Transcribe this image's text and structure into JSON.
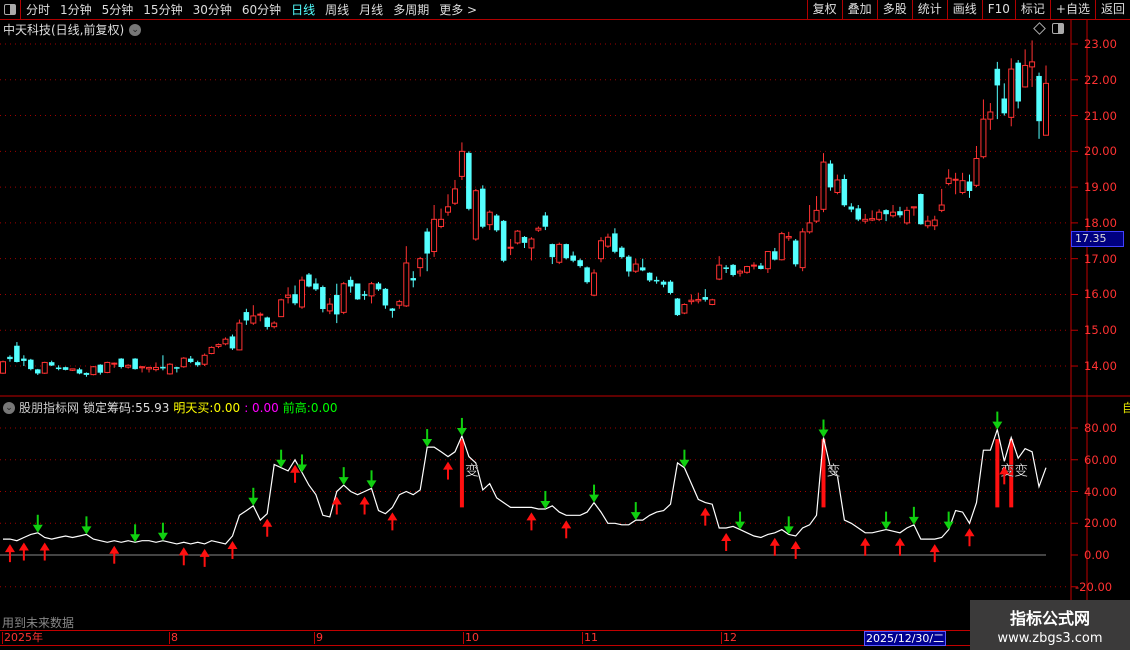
{
  "toolbar": {
    "periods": [
      "分时",
      "1分钟",
      "5分钟",
      "15分钟",
      "30分钟",
      "60分钟",
      "日线",
      "周线",
      "月线",
      "多周期",
      "更多 >"
    ],
    "active_period": "日线",
    "buttons": [
      "复权",
      "叠加",
      "多股",
      "统计",
      "画线",
      "F10",
      "标记",
      "+自选",
      "返回"
    ]
  },
  "stock": {
    "title": "中天科技(日线,前复权)"
  },
  "price_axis": {
    "labels": [
      "23.00",
      "22.00",
      "21.00",
      "20.00",
      "19.00",
      "18.00",
      "17.00",
      "16.00",
      "15.00",
      "14.00"
    ],
    "current_price": "17.35"
  },
  "indicator": {
    "name": "股朋指标网",
    "lock_label": "锁定筹码:",
    "lock_value": "55.93",
    "buy_label": "明天买:",
    "buy_value": "0.00",
    "magenta_value": ": 0.00",
    "high_label": "前高:",
    "high_value": "0.00",
    "axis_labels": [
      "80.00",
      "60.00",
      "40.00",
      "20.00",
      "0.00",
      "-20.00"
    ],
    "change_text": "变",
    "future_note": "用到未来数据"
  },
  "date_axis": {
    "labels": [
      "2025年",
      "8",
      "9",
      "10",
      "11",
      "12"
    ],
    "selected_date": "2025/12/30/二"
  },
  "sidebar": {
    "auto_label": "自"
  },
  "watermark": {
    "line1": "指标公式网",
    "line2": "www.zbgs3.com"
  },
  "colors": {
    "up": "#ff3232",
    "down": "#54ffff",
    "buy_arrow": "#ff1010",
    "sell_arrow": "#10d010",
    "line": "#ffffff",
    "grid": "#a00000",
    "active": "#54ffff"
  },
  "chart_data": [
    {
      "type": "candlestick",
      "ylim": [
        13.6,
        23.25
      ],
      "ohlc": [
        [
          13.8,
          14.15,
          13.78,
          14.12
        ],
        [
          14.25,
          14.3,
          14.12,
          14.2
        ],
        [
          14.56,
          14.67,
          14.1,
          14.12
        ],
        [
          14.2,
          14.3,
          14.0,
          14.15
        ],
        [
          14.17,
          14.2,
          13.88,
          13.92
        ],
        [
          13.9,
          13.92,
          13.75,
          13.8
        ],
        [
          13.8,
          14.12,
          13.78,
          14.1
        ],
        [
          14.1,
          14.15,
          14.0,
          14.02
        ],
        [
          13.95,
          14.02,
          13.88,
          13.94
        ],
        [
          13.96,
          13.98,
          13.88,
          13.9
        ],
        [
          13.88,
          13.93,
          13.86,
          13.92
        ],
        [
          13.9,
          13.95,
          13.77,
          13.8
        ],
        [
          13.8,
          13.82,
          13.7,
          13.76
        ],
        [
          13.76,
          14.0,
          13.74,
          13.98
        ],
        [
          14.03,
          14.05,
          13.76,
          13.82
        ],
        [
          13.82,
          14.12,
          13.8,
          14.1
        ],
        [
          14.08,
          14.1,
          13.95,
          14.08
        ],
        [
          14.2,
          14.22,
          13.93,
          13.98
        ],
        [
          13.97,
          14.05,
          13.93,
          14.02
        ],
        [
          14.2,
          14.22,
          13.9,
          13.92
        ],
        [
          13.95,
          14.0,
          13.82,
          13.98
        ],
        [
          13.92,
          13.98,
          13.82,
          13.96
        ],
        [
          13.9,
          14.1,
          13.85,
          13.96
        ],
        [
          13.97,
          14.3,
          13.88,
          13.94
        ],
        [
          13.78,
          14.08,
          13.76,
          14.05
        ],
        [
          13.96,
          13.98,
          13.82,
          13.94
        ],
        [
          13.98,
          14.25,
          13.95,
          14.22
        ],
        [
          14.2,
          14.28,
          14.08,
          14.12
        ],
        [
          14.1,
          14.15,
          13.98,
          14.03
        ],
        [
          14.05,
          14.35,
          14.0,
          14.3
        ],
        [
          14.35,
          14.55,
          14.33,
          14.52
        ],
        [
          14.55,
          14.63,
          14.5,
          14.6
        ],
        [
          14.62,
          14.8,
          14.58,
          14.75
        ],
        [
          14.82,
          14.88,
          14.45,
          14.5
        ],
        [
          14.45,
          15.3,
          14.44,
          15.2
        ],
        [
          15.5,
          15.6,
          15.15,
          15.28
        ],
        [
          15.2,
          15.7,
          15.15,
          15.4
        ],
        [
          15.45,
          15.5,
          15.25,
          15.45
        ],
        [
          15.35,
          15.38,
          15.02,
          15.1
        ],
        [
          15.1,
          15.25,
          15.05,
          15.2
        ],
        [
          15.38,
          15.88,
          15.37,
          15.85
        ],
        [
          15.92,
          16.2,
          15.75,
          15.98
        ],
        [
          16.0,
          16.25,
          15.7,
          15.76
        ],
        [
          15.65,
          16.5,
          15.6,
          16.4
        ],
        [
          16.55,
          16.6,
          16.2,
          16.23
        ],
        [
          16.3,
          16.45,
          16.1,
          16.15
        ],
        [
          16.2,
          16.25,
          15.5,
          15.6
        ],
        [
          15.54,
          15.9,
          15.45,
          15.73
        ],
        [
          15.98,
          16.3,
          15.2,
          15.45
        ],
        [
          15.5,
          16.35,
          15.45,
          16.3
        ],
        [
          16.4,
          16.5,
          16.05,
          16.23
        ],
        [
          16.3,
          16.3,
          15.85,
          15.87
        ],
        [
          16.0,
          16.1,
          15.85,
          15.97
        ],
        [
          15.96,
          16.35,
          15.75,
          16.3
        ],
        [
          16.3,
          16.35,
          16.1,
          16.15
        ],
        [
          16.15,
          16.18,
          15.6,
          15.7
        ],
        [
          15.6,
          15.62,
          15.35,
          15.55
        ],
        [
          15.7,
          15.85,
          15.6,
          15.8
        ],
        [
          15.68,
          17.35,
          15.65,
          16.88
        ],
        [
          16.45,
          16.65,
          16.2,
          16.4
        ],
        [
          16.75,
          17.05,
          16.5,
          17.0
        ],
        [
          17.75,
          17.85,
          16.65,
          17.15
        ],
        [
          17.2,
          18.5,
          17.05,
          18.1
        ],
        [
          17.9,
          18.4,
          17.85,
          18.1
        ],
        [
          18.3,
          18.8,
          18.2,
          18.45
        ],
        [
          18.55,
          19.2,
          18.5,
          18.95
        ],
        [
          19.3,
          20.25,
          19.2,
          20.0
        ],
        [
          19.95,
          20.0,
          18.35,
          18.4
        ],
        [
          17.55,
          18.95,
          17.5,
          18.9
        ],
        [
          18.95,
          19.05,
          17.85,
          17.9
        ],
        [
          17.95,
          18.35,
          17.8,
          18.3
        ],
        [
          18.2,
          18.25,
          17.75,
          17.8
        ],
        [
          18.05,
          18.08,
          16.9,
          16.95
        ],
        [
          17.3,
          17.55,
          17.1,
          17.32
        ],
        [
          17.44,
          17.8,
          17.4,
          17.77
        ],
        [
          17.6,
          17.63,
          17.3,
          17.45
        ],
        [
          17.3,
          17.6,
          16.95,
          17.55
        ],
        [
          17.8,
          17.9,
          17.75,
          17.85
        ],
        [
          18.2,
          18.3,
          17.8,
          17.9
        ],
        [
          17.4,
          17.42,
          16.85,
          17.05
        ],
        [
          16.9,
          17.45,
          16.85,
          17.4
        ],
        [
          17.4,
          17.42,
          16.98,
          17.02
        ],
        [
          17.08,
          17.2,
          16.9,
          16.95
        ],
        [
          16.95,
          17.0,
          16.75,
          16.8
        ],
        [
          16.75,
          16.78,
          16.3,
          16.35
        ],
        [
          15.98,
          16.7,
          15.95,
          16.6
        ],
        [
          17.0,
          17.6,
          16.9,
          17.5
        ],
        [
          17.35,
          17.7,
          17.3,
          17.6
        ],
        [
          17.7,
          17.85,
          17.15,
          17.2
        ],
        [
          17.3,
          17.35,
          17.0,
          17.05
        ],
        [
          17.05,
          17.1,
          16.5,
          16.65
        ],
        [
          16.65,
          17.0,
          16.6,
          16.85
        ],
        [
          16.75,
          17.0,
          16.65,
          16.68
        ],
        [
          16.6,
          16.62,
          16.35,
          16.4
        ],
        [
          16.4,
          16.5,
          16.3,
          16.38
        ],
        [
          16.35,
          16.4,
          16.2,
          16.28
        ],
        [
          16.35,
          16.4,
          16.0,
          16.05
        ],
        [
          15.88,
          15.9,
          15.4,
          15.43
        ],
        [
          15.48,
          15.75,
          15.45,
          15.72
        ],
        [
          15.8,
          16.0,
          15.72,
          15.84
        ],
        [
          15.82,
          16.05,
          15.75,
          15.86
        ],
        [
          15.92,
          16.15,
          15.8,
          15.86
        ],
        [
          15.72,
          15.88,
          15.7,
          15.85
        ],
        [
          16.43,
          17.07,
          16.4,
          16.82
        ],
        [
          16.75,
          16.82,
          16.6,
          16.72
        ],
        [
          16.82,
          16.85,
          16.5,
          16.55
        ],
        [
          16.6,
          16.7,
          16.5,
          16.65
        ],
        [
          16.62,
          16.8,
          16.58,
          16.78
        ],
        [
          16.8,
          16.9,
          16.7,
          16.82
        ],
        [
          16.8,
          16.88,
          16.7,
          16.72
        ],
        [
          16.72,
          17.2,
          16.6,
          17.2
        ],
        [
          17.2,
          17.3,
          16.95,
          16.98
        ],
        [
          16.97,
          17.75,
          16.95,
          17.7
        ],
        [
          17.58,
          17.75,
          17.5,
          17.62
        ],
        [
          17.5,
          17.55,
          16.78,
          16.85
        ],
        [
          16.75,
          17.85,
          16.65,
          17.75
        ],
        [
          17.75,
          18.5,
          17.7,
          18.0
        ],
        [
          18.05,
          18.75,
          18.0,
          18.35
        ],
        [
          18.38,
          19.95,
          18.3,
          19.7
        ],
        [
          19.65,
          19.75,
          18.9,
          19.0
        ],
        [
          18.85,
          19.35,
          18.8,
          19.2
        ],
        [
          19.22,
          19.35,
          18.45,
          18.5
        ],
        [
          18.45,
          18.55,
          18.3,
          18.38
        ],
        [
          18.4,
          18.5,
          18.05,
          18.1
        ],
        [
          18.05,
          18.25,
          17.98,
          18.1
        ],
        [
          18.08,
          18.35,
          18.05,
          18.12
        ],
        [
          18.1,
          18.38,
          18.05,
          18.3
        ],
        [
          18.35,
          18.38,
          18.05,
          18.25
        ],
        [
          18.2,
          18.5,
          18.15,
          18.3
        ],
        [
          18.32,
          18.45,
          18.15,
          18.22
        ],
        [
          18.0,
          18.45,
          17.95,
          18.35
        ],
        [
          18.42,
          18.45,
          18.2,
          18.45
        ],
        [
          18.8,
          18.82,
          17.95,
          17.97
        ],
        [
          17.92,
          18.2,
          17.85,
          18.05
        ],
        [
          17.92,
          18.2,
          17.8,
          18.08
        ],
        [
          18.35,
          18.95,
          18.3,
          18.5
        ],
        [
          19.1,
          19.5,
          19.05,
          19.25
        ],
        [
          19.2,
          19.4,
          18.8,
          19.22
        ],
        [
          18.85,
          19.4,
          18.8,
          19.18
        ],
        [
          19.15,
          19.35,
          18.7,
          18.9
        ],
        [
          19.05,
          20.15,
          19.0,
          19.8
        ],
        [
          19.85,
          21.45,
          19.8,
          20.9
        ],
        [
          20.9,
          21.35,
          20.6,
          21.1
        ],
        [
          22.3,
          22.5,
          20.9,
          21.85
        ],
        [
          21.47,
          21.9,
          21.0,
          21.07
        ],
        [
          20.95,
          22.6,
          20.7,
          22.3
        ],
        [
          22.47,
          22.55,
          21.2,
          21.4
        ],
        [
          21.8,
          22.85,
          21.78,
          22.4
        ],
        [
          22.36,
          23.1,
          21.8,
          22.5
        ],
        [
          22.1,
          22.2,
          20.35,
          20.85
        ],
        [
          20.45,
          22.4,
          20.45,
          21.9
        ]
      ]
    },
    {
      "type": "line",
      "ylim": [
        -25,
        92
      ],
      "values": [
        10,
        10,
        9,
        11,
        13,
        14,
        11,
        10,
        11,
        12,
        11,
        12,
        13,
        10,
        9,
        8,
        9,
        8,
        9,
        8,
        9,
        9,
        8,
        9,
        8,
        7,
        8,
        7,
        8,
        7,
        9,
        8,
        7,
        12,
        25,
        28,
        31,
        22,
        26,
        57,
        55,
        53,
        60,
        52,
        44,
        38,
        25,
        24,
        40,
        44,
        40,
        38,
        40,
        42,
        28,
        26,
        30,
        38,
        40,
        38,
        41,
        68,
        68,
        65,
        62,
        65,
        75,
        62,
        58,
        41,
        45,
        36,
        33,
        30,
        30,
        30,
        30,
        29,
        29,
        31,
        27,
        25,
        25,
        25,
        27,
        33,
        27,
        20,
        20,
        19,
        19,
        22,
        22,
        25,
        27,
        28,
        32,
        58,
        55,
        45,
        35,
        33,
        32,
        17,
        17,
        18,
        16,
        14,
        12,
        11,
        13,
        14,
        16,
        13,
        12,
        17,
        19,
        25,
        74,
        55,
        50,
        22,
        20,
        17,
        14,
        14,
        15,
        16,
        15,
        14,
        17,
        19,
        10,
        10,
        10,
        11,
        16,
        28,
        27,
        20,
        33,
        66,
        66,
        79,
        59,
        74,
        61,
        67,
        65,
        43,
        55
      ],
      "buy_arrows": [
        1,
        3,
        6,
        16,
        26,
        29,
        33,
        38,
        42,
        48,
        52,
        56,
        64,
        76,
        81,
        101,
        104,
        111,
        114,
        124,
        129,
        134,
        139,
        144
      ],
      "sell_arrows": [
        5,
        12,
        19,
        23,
        36,
        40,
        43,
        49,
        53,
        61,
        66,
        78,
        85,
        91,
        98,
        106,
        113,
        118,
        127,
        131,
        136,
        143
      ],
      "change_bars": [
        66,
        118,
        143,
        145
      ],
      "change_bar_range": [
        30,
        73
      ],
      "change_labels": [
        67,
        119,
        144,
        146
      ]
    }
  ]
}
